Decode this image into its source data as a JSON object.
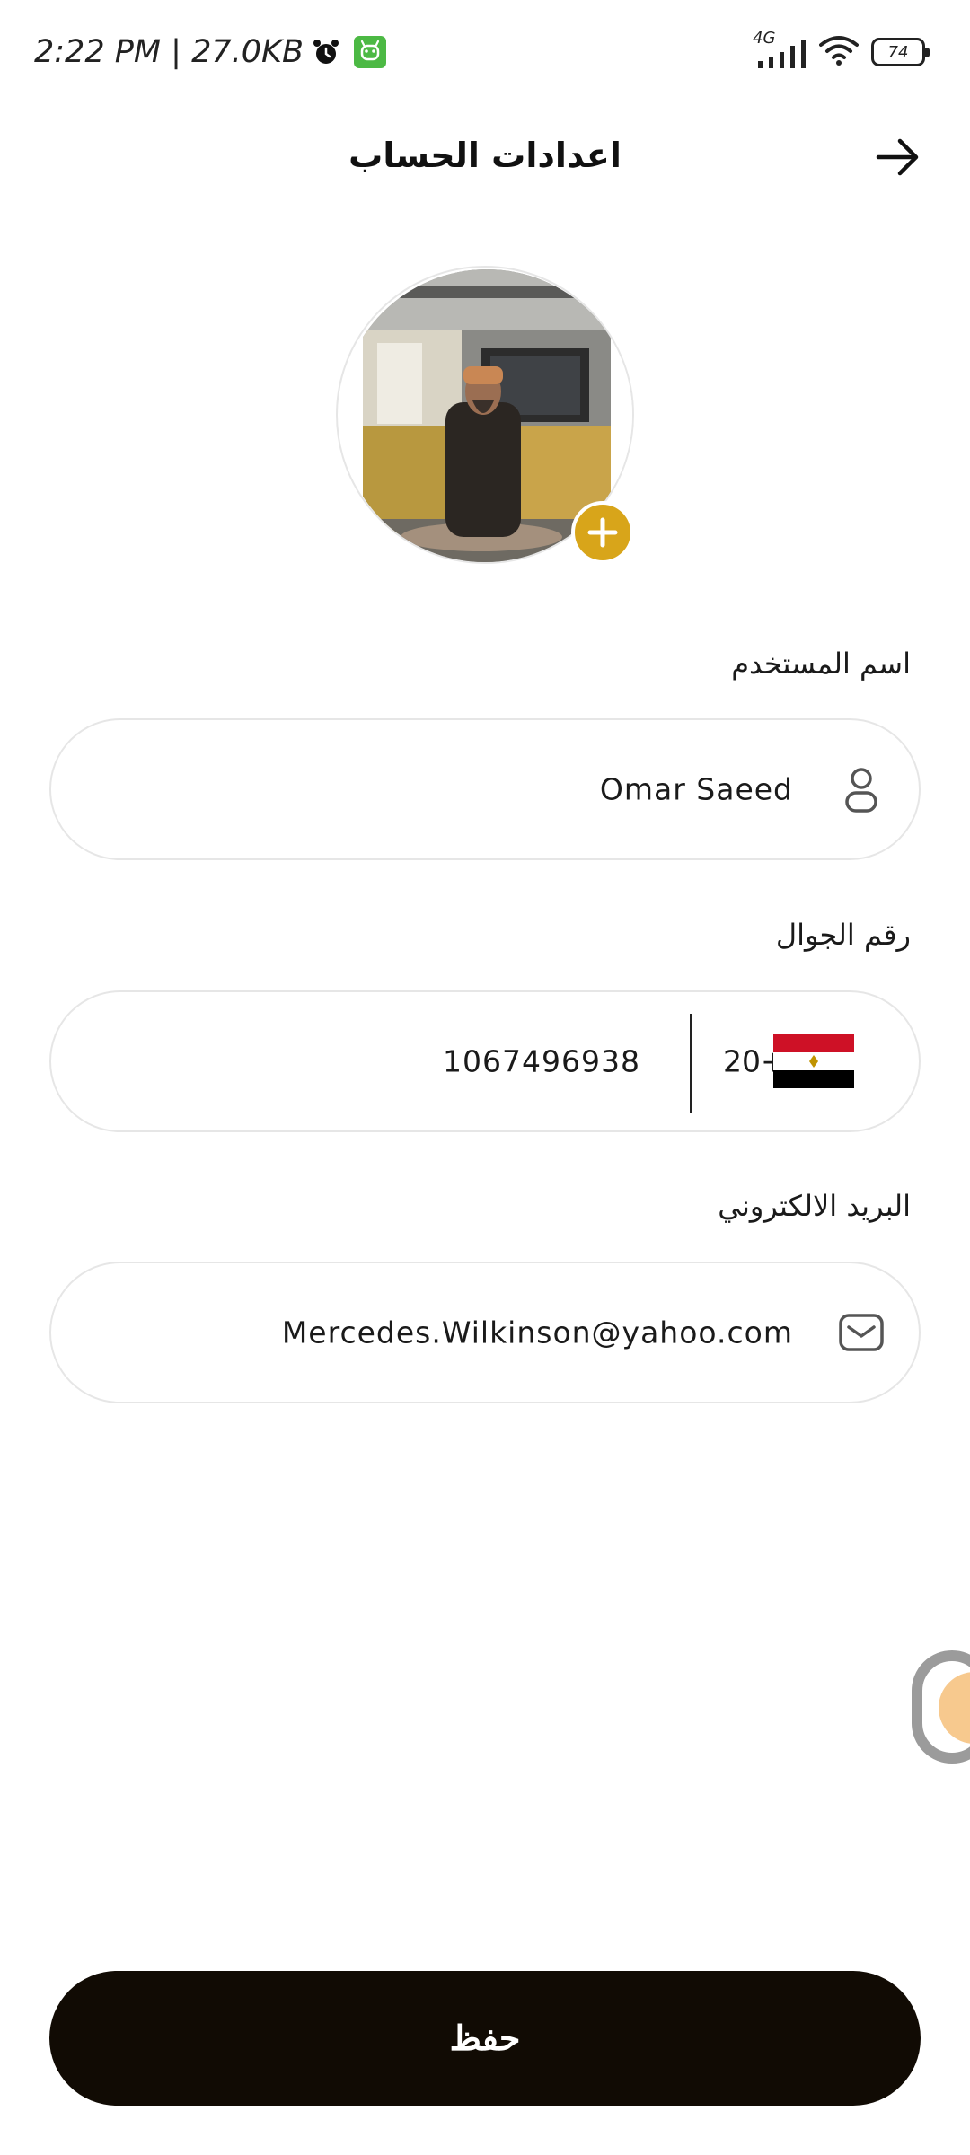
{
  "status_bar": {
    "time_info": "2:22 PM | 27.0KB",
    "network": "4G",
    "battery": "74",
    "icons": [
      "alarm-icon",
      "app-badge-icon",
      "signal-icon",
      "wifi-icon",
      "battery-icon"
    ]
  },
  "header": {
    "title": "اعدادات الحساب",
    "back_icon": "arrow-right-icon"
  },
  "profile": {
    "add_photo_icon": "plus-icon"
  },
  "form": {
    "username": {
      "label": "اسم المستخدم",
      "value": "Omar Saeed",
      "icon": "user-icon"
    },
    "phone": {
      "label": "رقم الجوال",
      "value": "1067496938",
      "country_code": "20+",
      "flag": "egypt-flag"
    },
    "email": {
      "label": "البريد الالكتروني",
      "value": "Mercedes.Wilkinson@yahoo.com",
      "icon": "mail-icon"
    }
  },
  "actions": {
    "save_label": "حفظ"
  },
  "colors": {
    "accent": "#d8a51a",
    "save_button": "#110b04",
    "field_border": "#e6e6e6"
  }
}
